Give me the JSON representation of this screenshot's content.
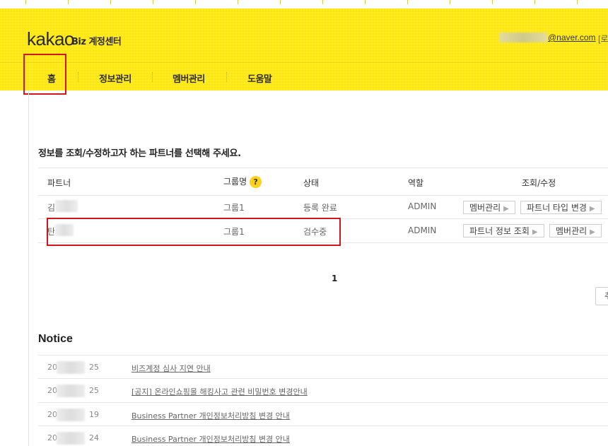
{
  "header": {
    "logo": "kakao",
    "logo_sub": "Biz 계정센터",
    "email": "@naver.com",
    "logout": "로그아웃"
  },
  "nav": {
    "tabs": [
      {
        "label": "홈"
      },
      {
        "label": "정보관리"
      },
      {
        "label": "멤버관리"
      },
      {
        "label": "도움말"
      }
    ]
  },
  "main": {
    "instruction": "정보를 조회/수정하고자 하는 파트너를 선택해 주세요.",
    "table": {
      "headers": {
        "partner": "파트너",
        "group": "그룹명",
        "group_help": "?",
        "status": "상태",
        "role": "역할",
        "actions": "조회/수정"
      },
      "rows": [
        {
          "partner": "김",
          "group": "그룹1",
          "status": "등록 완료",
          "role": "ADMIN",
          "btn1": "멤버관리",
          "btn2": "파트너 타입 변경"
        },
        {
          "partner": "탄",
          "group": "그룹1",
          "status": "검수중",
          "role": "ADMIN",
          "btn1": "파트너 정보 조회",
          "btn2": "멤버관리"
        }
      ]
    },
    "pagination": {
      "current": "1"
    },
    "side_button": "추가"
  },
  "notice": {
    "title": "Notice",
    "items": [
      {
        "date_start": "20",
        "date_end": "25",
        "title": "비즈계정 심사 지연 안내"
      },
      {
        "date_start": "20",
        "date_end": "25",
        "title": "[공지] 온라인쇼핑몰 해킹사고 관련 비밀번호 변경안내"
      },
      {
        "date_start": "20",
        "date_end": "19",
        "title": "Business Partner 개인정보처리방침 변경 안내"
      },
      {
        "date_start": "20",
        "date_end": "24",
        "title": "Business Partner 개인정보처리방침 변경 안내"
      }
    ]
  },
  "colors": {
    "brand_yellow": "#ffe812",
    "highlight_red": "#d3161c",
    "help_icon": "#ffd21a"
  }
}
